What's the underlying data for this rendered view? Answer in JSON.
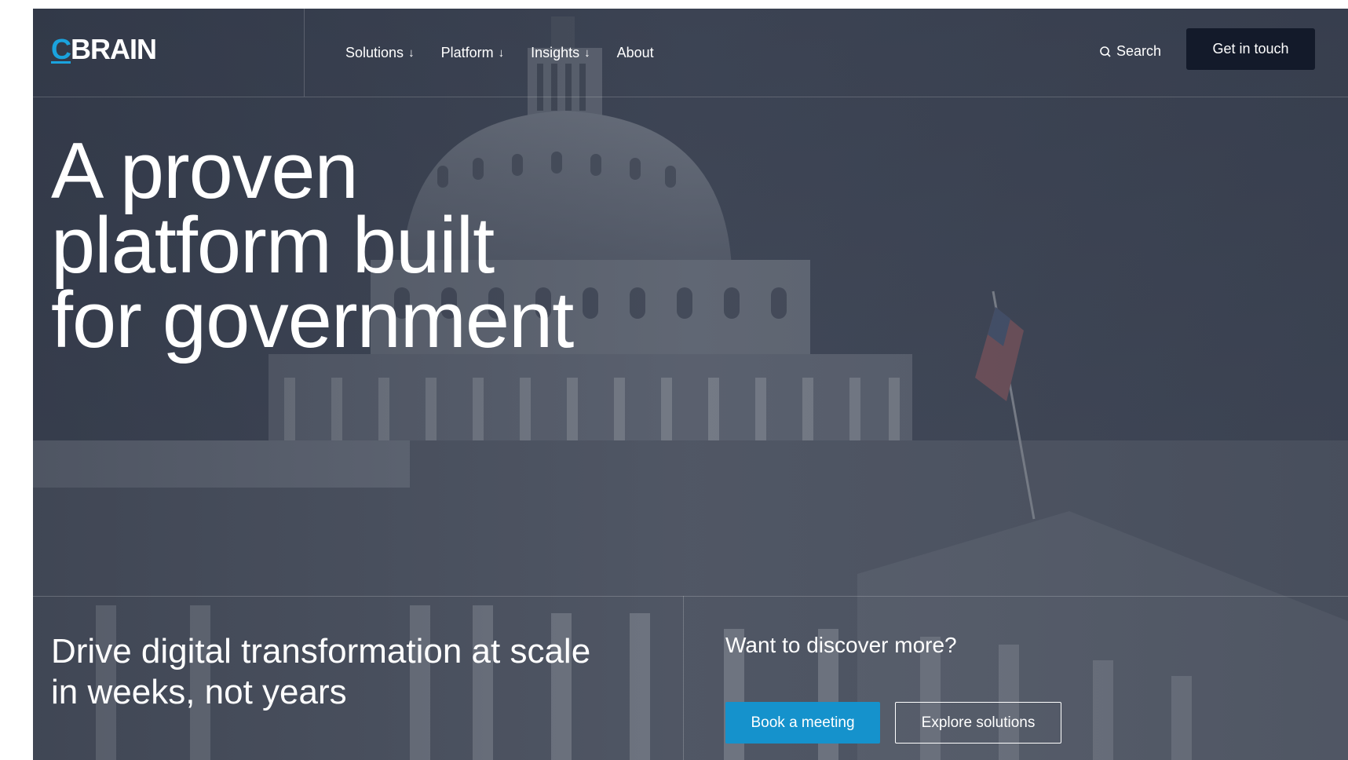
{
  "header": {
    "logo_c": "C",
    "logo_rest": "BRAIN",
    "nav": [
      {
        "label": "Solutions",
        "arrow": "↓"
      },
      {
        "label": "Platform",
        "arrow": "↓"
      },
      {
        "label": "Insights",
        "arrow": "↓"
      },
      {
        "label": "About"
      }
    ],
    "search_label": "Search",
    "cta_label": "Get in touch"
  },
  "hero": {
    "headline_lines": [
      "A proven",
      "platform built",
      "for government"
    ],
    "subheadline": "Drive digital transformation at scale in weeks, not years",
    "discover_label": "Want to discover more?",
    "primary_button": "Book a meeting",
    "secondary_button": "Explore solutions",
    "background_image": "capitol-building-photo"
  },
  "colors": {
    "brand_accent": "#1aa3de",
    "primary_button": "#1592cc",
    "cta_background": "#131a2a"
  }
}
